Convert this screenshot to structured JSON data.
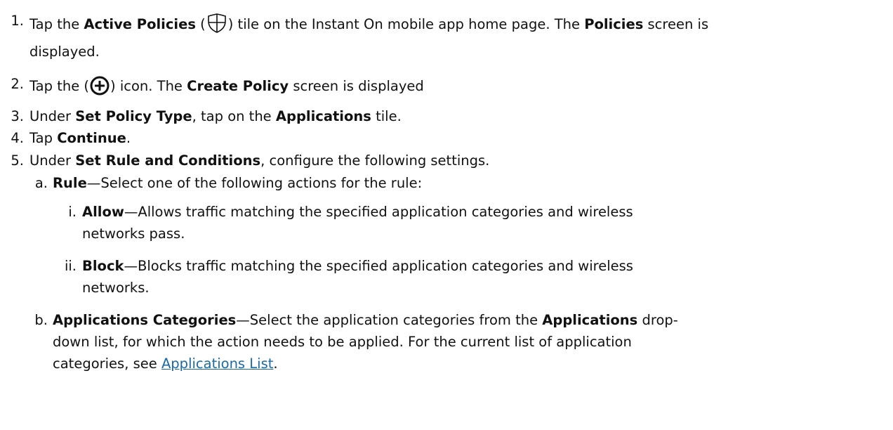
{
  "steps": [
    {
      "num": "1.",
      "p1": "Tap the ",
      "b1": "Active Policies",
      "p2": " (",
      "p3": ") tile on the Instant On mobile app home page. The ",
      "b2": "Policies",
      "p4": " screen is",
      "cont": "displayed.",
      "icon": "shield-plus-icon"
    },
    {
      "num": "2.",
      "p1": "Tap the (",
      "p2": ") icon. The ",
      "b1": "Create Policy",
      "p3": " screen is displayed",
      "icon": "circle-plus-icon"
    },
    {
      "num": "3.",
      "p1": "Under ",
      "b1": "Set Policy Type",
      "p2": ", tap on the ",
      "b2": "Applications",
      "p3": " tile."
    },
    {
      "num": "4.",
      "p1": "Tap ",
      "b1": "Continue",
      "p2": "."
    },
    {
      "num": "5.",
      "p1": "Under ",
      "b1": "Set Rule and Conditions",
      "p2": ", configure the following settings."
    }
  ],
  "sub_a": {
    "label": "a.",
    "b1": "Rule",
    "p1": "—Select one of the following actions for the rule:"
  },
  "sub_a_items": [
    {
      "label": "i.",
      "b1": "Allow",
      "l1": "—Allows traffic matching the specified application categories and wireless",
      "l2": "networks pass."
    },
    {
      "label": "ii.",
      "b1": "Block",
      "l1": "—Blocks traffic matching the specified application categories and wireless",
      "l2": "networks."
    }
  ],
  "sub_b": {
    "label": "b.",
    "b1": "Applications Categories",
    "p1": "—Select the application categories from the ",
    "b2": "Applications",
    "p2": " drop-",
    "l2": "down list, for which the action needs to be applied. For the current list of application",
    "l3": "categories, see ",
    "link": "Applications List",
    "end": "."
  }
}
